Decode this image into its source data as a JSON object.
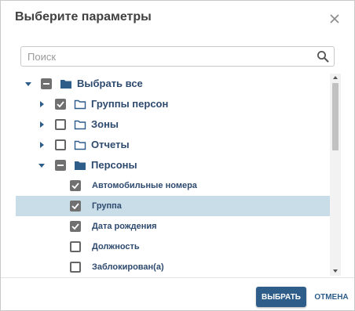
{
  "dialog": {
    "title": "Выберите параметры",
    "close_icon": "close-icon"
  },
  "search": {
    "placeholder": "Поиск",
    "value": "",
    "icon": "search-icon"
  },
  "tree": {
    "root": {
      "label": "Выбрать все",
      "expanded": true,
      "state": "partial"
    },
    "items": [
      {
        "label": "Группы персон",
        "expanded": false,
        "state": "checked",
        "folder": "outline"
      },
      {
        "label": "Зоны",
        "expanded": false,
        "state": "unchecked",
        "folder": "outline"
      },
      {
        "label": "Отчеты",
        "expanded": false,
        "state": "unchecked",
        "folder": "outline"
      },
      {
        "label": "Персоны",
        "expanded": true,
        "state": "partial",
        "folder": "filled"
      }
    ],
    "leaves": [
      {
        "label": "Автомобильные номера",
        "state": "checked",
        "selected": false
      },
      {
        "label": "Группа",
        "state": "checked",
        "selected": true
      },
      {
        "label": "Дата рождения",
        "state": "checked",
        "selected": false
      },
      {
        "label": "Должность",
        "state": "unchecked",
        "selected": false
      },
      {
        "label": "Заблокирован(а)",
        "state": "unchecked",
        "selected": false
      }
    ]
  },
  "footer": {
    "ok_label": "ВЫБРАТЬ",
    "cancel_label": "ОТМЕНА"
  },
  "colors": {
    "accent": "#2f5d8a",
    "label": "#2e4a6e",
    "selection": "#c9dde9",
    "checkbox": "#707070"
  }
}
